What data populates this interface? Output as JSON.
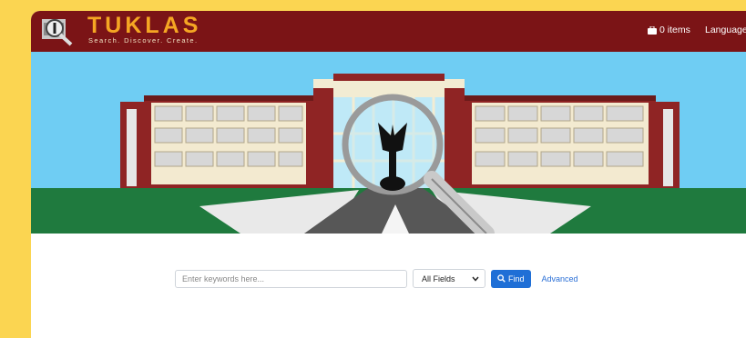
{
  "header": {
    "brand": "TUKLAS",
    "tagline": "Search. Discover. Create.",
    "cart_label": "0 items",
    "language_label": "Language -"
  },
  "search": {
    "placeholder": "Enter keywords here...",
    "field_selected": "All Fields",
    "find_label": "Find",
    "advanced_label": "Advanced"
  },
  "colors": {
    "header_bg": "#7b1416",
    "brand": "#f5a623",
    "accent": "#1f6fd6",
    "page_border": "#fbd551"
  },
  "icons": [
    "briefcase-icon",
    "search-icon",
    "chevron-down-icon",
    "magnifier-logo-icon"
  ]
}
